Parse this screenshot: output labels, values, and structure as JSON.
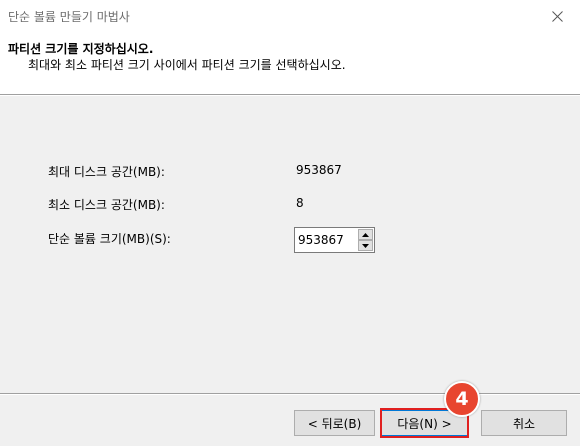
{
  "window": {
    "title": "단순 볼륨 만들기 마법사"
  },
  "header": {
    "title": "파티션 크기를 지정하십시오.",
    "subtitle": "최대와 최소 파티션 크기 사이에서 파티션 크기를 선택하십시오."
  },
  "fields": {
    "max_label": "최대 디스크 공간(MB):",
    "max_value": "953867",
    "min_label": "최소 디스크 공간(MB):",
    "min_value": "8",
    "size_label": "단순 볼륨 크기(MB)(S):",
    "size_value": "953867"
  },
  "buttons": {
    "back": "< 뒤로(B)",
    "next": "다음(N) >",
    "cancel": "취소"
  },
  "annotation": {
    "step": "4",
    "color": "#e8452f"
  },
  "icons": {
    "close": "close-icon",
    "spin_up": "arrow-up-icon",
    "spin_down": "arrow-down-icon"
  }
}
